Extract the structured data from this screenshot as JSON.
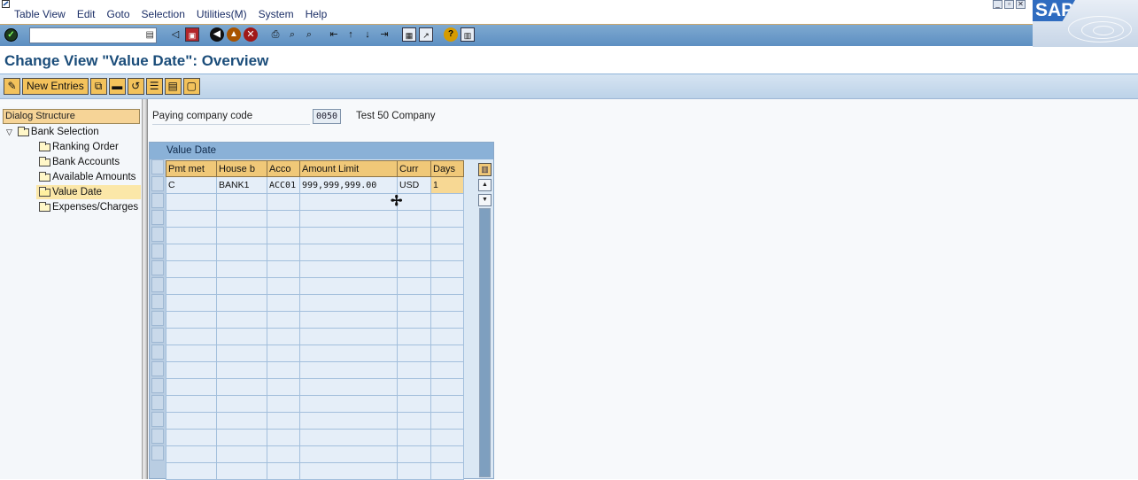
{
  "menubar": {
    "items": [
      "Table View",
      "Edit",
      "Goto",
      "Selection",
      "Utilities(M)",
      "System",
      "Help"
    ]
  },
  "logo": {
    "text": "SAP"
  },
  "toolbar": {
    "command_field_value": ""
  },
  "title": "Change View \"Value Date\": Overview",
  "app_toolbar": {
    "new_entries_label": "New Entries"
  },
  "dialog_structure": {
    "header": "Dialog Structure",
    "root": "Bank Selection",
    "items": [
      "Ranking Order",
      "Bank Accounts",
      "Available Amounts",
      "Value Date",
      "Expenses/Charges"
    ],
    "selected": "Value Date"
  },
  "field": {
    "label": "Paying company code",
    "value": "0050",
    "description": "Test 50 Company"
  },
  "table": {
    "title": "Value Date",
    "columns": [
      "Pmt met",
      "House b",
      "Acco",
      "Amount Limit",
      "Curr",
      "Days"
    ],
    "rows": [
      [
        "C",
        "BANK1",
        "ACC01",
        "999,999,999.00",
        "USD",
        "1"
      ]
    ],
    "visible_row_count": 18
  },
  "colors": {
    "toolbar_blue": "#5d8fc2",
    "title_text": "#1b4d7a",
    "header_orange": "#f0c878",
    "grid_blue": "#e5eef8"
  },
  "icons": {
    "toolbar": [
      "enter-icon",
      "back-icon",
      "exit-icon",
      "cancel-icon",
      "print-icon",
      "find-icon",
      "find-next-icon",
      "first-page-icon",
      "previous-page-icon",
      "next-page-icon",
      "last-page-icon",
      "create-session-icon",
      "shortcut-icon",
      "help-icon",
      "layout-icon"
    ]
  }
}
